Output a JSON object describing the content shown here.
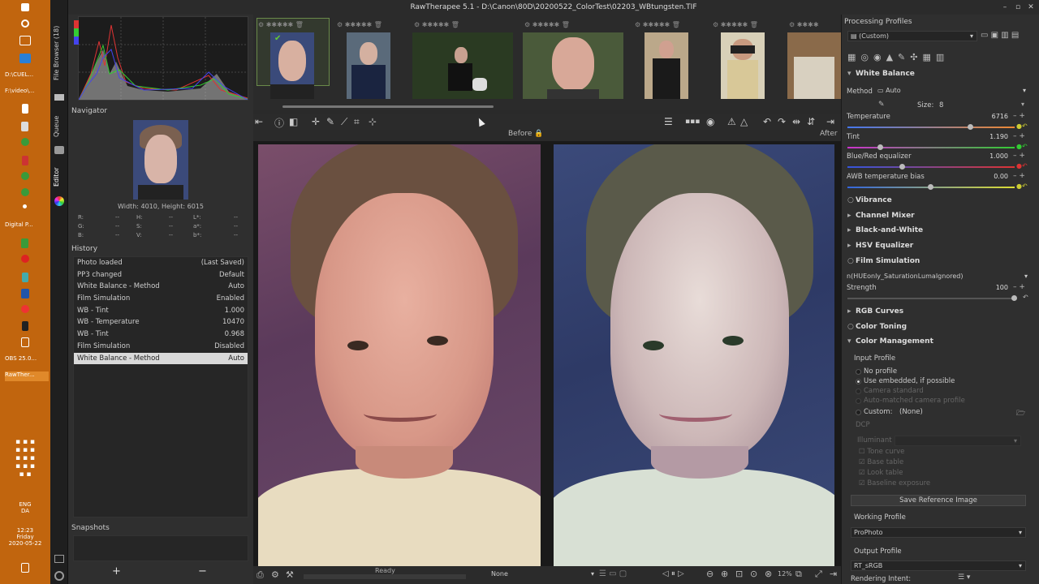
{
  "window": {
    "title": "RawTherapee 5.1 - D:\\Canon\\80D\\20200522_ColorTest\\02203_WBtungsten.TIF"
  },
  "taskbar": {
    "items": [
      "D:\\CUEL...",
      "F:\\video\\...",
      "Digital P...",
      "OBS 25.0...",
      "RawTher..."
    ],
    "lang1": "ENG",
    "lang2": "DA",
    "time": "12:23",
    "day": "Friday",
    "date": "2020-05-22"
  },
  "side_tabs": {
    "file_browser": "File Browser (18)",
    "queue": "Queue",
    "editor": "Editor"
  },
  "navigator": {
    "label": "Navigator",
    "size": "Width: 4010, Height: 6015",
    "r": "R:",
    "g": "G:",
    "b": "B:",
    "h": "H:",
    "s": "S:",
    "v": "V:",
    "l": "L*:",
    "a": "a*:",
    "bstar": "b*:",
    "dash": "--"
  },
  "history": {
    "label": "History",
    "rows": [
      {
        "name": "Photo loaded",
        "value": "(Last Saved)"
      },
      {
        "name": "PP3 changed",
        "value": "Default"
      },
      {
        "name": "White Balance - Method",
        "value": "Auto"
      },
      {
        "name": "Film Simulation",
        "value": "Enabled"
      },
      {
        "name": "WB - Tint",
        "value": "1.000"
      },
      {
        "name": "WB - Temperature",
        "value": "10470"
      },
      {
        "name": "WB - Tint",
        "value": "0.968"
      },
      {
        "name": "Film Simulation",
        "value": "Disabled"
      },
      {
        "name": "White Balance - Method",
        "value": "Auto"
      }
    ]
  },
  "snapshots": {
    "label": "Snapshots",
    "add": "+",
    "remove": "−"
  },
  "viewer": {
    "before_label": "Before",
    "after_label": "After"
  },
  "status": {
    "ready": "Ready",
    "none": "None",
    "zoom": "12%"
  },
  "processing": {
    "title": "Processing Profiles",
    "profile": "(Custom)",
    "white_balance": {
      "title": "White Balance",
      "method_label": "Method",
      "method_value": "Auto",
      "size_label": "Size:",
      "size_value": "8",
      "temperature_label": "Temperature",
      "temperature_value": "6716",
      "temperature_level": 0.74,
      "tint_label": "Tint",
      "tint_value": "1.190",
      "tint_level": 0.2,
      "br_label": "Blue/Red equalizer",
      "br_value": "1.000",
      "br_level": 0.33,
      "awb_label": "AWB temperature bias",
      "awb_value": "0.00",
      "awb_level": 0.5
    },
    "sections": {
      "vibrance": "Vibrance",
      "channel_mixer": "Channel Mixer",
      "bw": "Black-and-White",
      "hsv": "HSV Equalizer",
      "film": "Film Simulation",
      "rgb_curves": "RGB Curves",
      "color_toning": "Color Toning",
      "color_management": "Color Management"
    },
    "film": {
      "lut": "n(HUEonly_SaturationLumaIgnored)",
      "strength_label": "Strength",
      "strength_value": "100",
      "strength_level": 1.0
    },
    "color_management": {
      "input_profile": "Input Profile",
      "no_profile": "No profile",
      "use_embedded": "Use embedded, if possible",
      "camera_standard": "Camera standard",
      "auto_matched": "Auto-matched camera profile",
      "custom_label": "Custom:",
      "custom_value": "(None)",
      "dcp": "DCP",
      "illuminant": "Illuminant",
      "tone_curve": "Tone curve",
      "base_table": "Base table",
      "look_table": "Look table",
      "baseline_exposure": "Baseline exposure",
      "save_ref": "Save Reference Image",
      "working_profile": "Working Profile",
      "working_value": "ProPhoto",
      "output_profile": "Output Profile",
      "output_value": "RT_sRGB",
      "rendering_intent": "Rendering Intent:"
    }
  },
  "colors": {
    "taskbar": "#c1650e",
    "panel": "#2f2f2f",
    "selected_row": "#d9d9d9"
  }
}
